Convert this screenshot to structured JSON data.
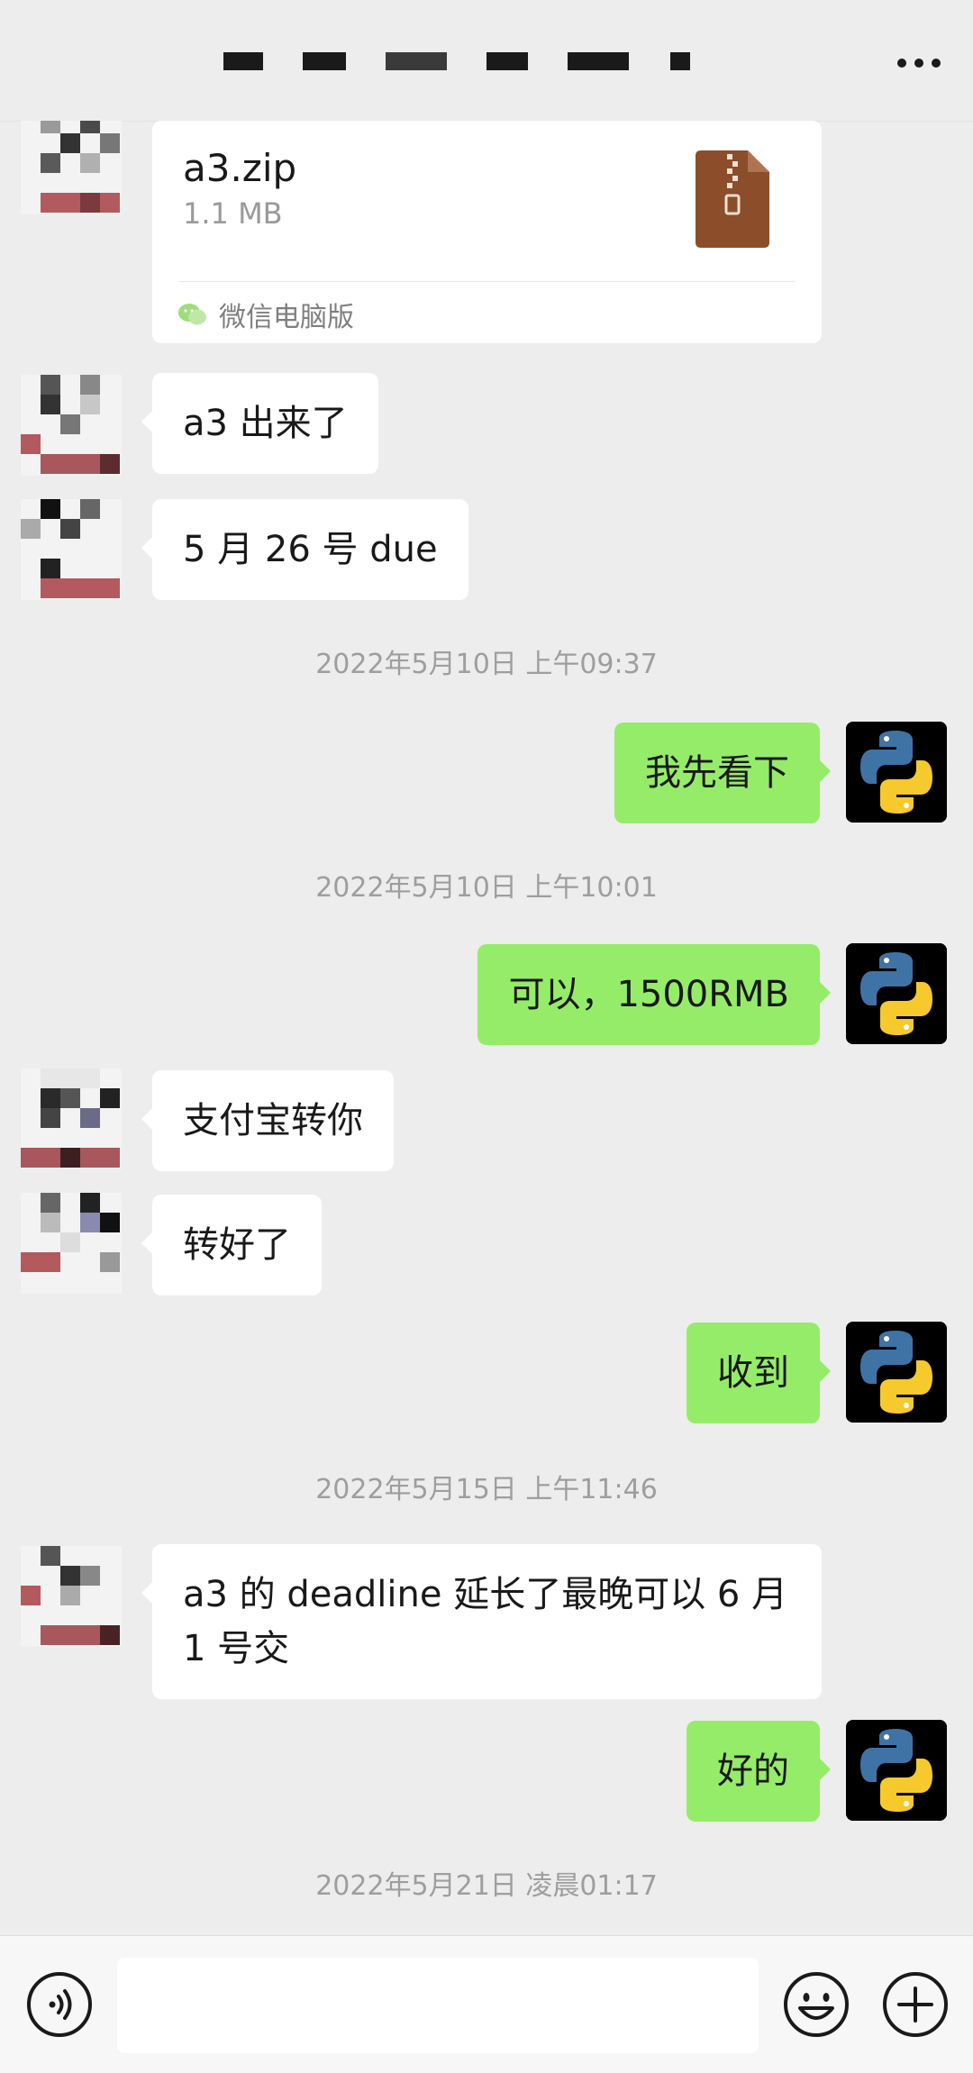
{
  "header": {
    "title_redacted": true,
    "menu_icon": "more-dots-icon"
  },
  "file_message": {
    "name": "a3.zip",
    "size": "1.1 MB",
    "source": "微信电脑版",
    "file_icon": "zip-archive-icon",
    "source_icon": "wechat-icon"
  },
  "messages": [
    {
      "side": "in",
      "text": "a3 出来了"
    },
    {
      "side": "in",
      "text": "5 月 26 号 due"
    },
    {
      "side": "out",
      "text": "我先看下"
    },
    {
      "side": "out",
      "text": "可以，1500RMB"
    },
    {
      "side": "in",
      "text": "支付宝转你"
    },
    {
      "side": "in",
      "text": "转好了"
    },
    {
      "side": "out",
      "text": "收到"
    },
    {
      "side": "in",
      "text": "a3 的 deadline 延长了最晚可以 6 月 1 号交"
    },
    {
      "side": "out",
      "text": "好的"
    }
  ],
  "timestamps": [
    "2022年5月10日 上午09:37",
    "2022年5月10日 上午10:01",
    "2022年5月15日 上午11:46",
    "2022年5月21日 凌晨01:17"
  ],
  "input_bar": {
    "voice_icon": "voice-icon",
    "emoji_icon": "emoji-icon",
    "plus_icon": "plus-icon",
    "value": ""
  },
  "colors": {
    "background": "#ededed",
    "incoming_bubble": "#ffffff",
    "outgoing_bubble": "#95ec69",
    "timestamp_text": "#9e9e9e"
  }
}
